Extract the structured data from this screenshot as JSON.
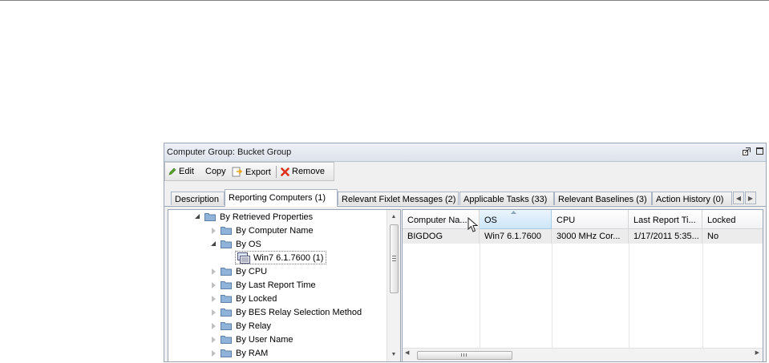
{
  "window": {
    "title": "Computer Group: Bucket Group"
  },
  "toolbar": {
    "edit_label": "Edit",
    "copy_label": "Copy",
    "export_label": "Export",
    "remove_label": "Remove"
  },
  "tabs": [
    {
      "label": "Description",
      "active": false
    },
    {
      "label": "Reporting Computers (1)",
      "active": true
    },
    {
      "label": "Relevant Fixlet Messages (2)",
      "active": false
    },
    {
      "label": "Applicable Tasks (33)",
      "active": false
    },
    {
      "label": "Relevant Baselines (3)",
      "active": false
    },
    {
      "label": "Action History (0)",
      "active": false
    }
  ],
  "tree": {
    "items": [
      {
        "label": "By Retrieved Properties",
        "expanded": true
      },
      {
        "label": "By Computer Name",
        "expanded": false
      },
      {
        "label": "By OS",
        "expanded": true
      },
      {
        "label": "Win7 6.1.7600 (1)",
        "selected": true
      },
      {
        "label": "By CPU",
        "expanded": false
      },
      {
        "label": "By Last Report Time",
        "expanded": false
      },
      {
        "label": "By Locked",
        "expanded": false
      },
      {
        "label": "By BES Relay Selection Method",
        "expanded": false
      },
      {
        "label": "By Relay",
        "expanded": false
      },
      {
        "label": "By User Name",
        "expanded": false
      },
      {
        "label": "By RAM",
        "expanded": false
      }
    ]
  },
  "grid": {
    "columns": [
      "Computer Na...",
      "OS",
      "CPU",
      "Last Report Ti...",
      "Locked"
    ],
    "rows": [
      [
        "BIGDOG",
        "Win7 6.1.7600",
        "3000 MHz Cor...",
        "1/17/2011 5:35...",
        "No"
      ]
    ],
    "sorted_column": "OS"
  },
  "colors": {
    "remove_icon": "#e0301e",
    "edit_icon": "#5aa02c",
    "folder": "#8fb3d9",
    "sorted_header": "#cde6f8"
  }
}
